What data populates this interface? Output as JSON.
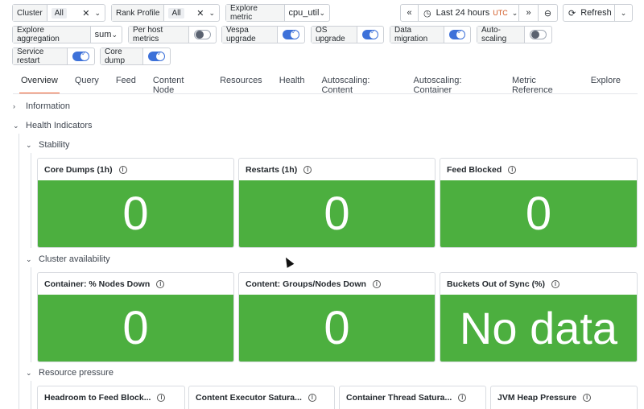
{
  "controls": {
    "cluster": {
      "label": "Cluster",
      "value": "All"
    },
    "rank_profile": {
      "label": "Rank Profile",
      "value": "All"
    },
    "explore_metric": {
      "label": "Explore metric",
      "value": "cpu_util"
    },
    "explore_aggregation": {
      "label": "Explore aggregation",
      "value": "sum"
    },
    "per_host_metrics": {
      "label": "Per host metrics",
      "on": false
    },
    "vespa_upgrade": {
      "label": "Vespa upgrade",
      "on": true
    },
    "os_upgrade": {
      "label": "OS upgrade",
      "on": true
    },
    "data_migration": {
      "label": "Data migration",
      "on": true
    },
    "auto_scaling": {
      "label": "Auto-scaling",
      "on": false
    },
    "service_restart": {
      "label": "Service restart",
      "on": true
    },
    "core_dump": {
      "label": "Core dump",
      "on": true
    }
  },
  "timebar": {
    "range_label": "Last 24 hours",
    "tz": "UTC",
    "refresh_label": "Refresh"
  },
  "tabs": [
    "Overview",
    "Query",
    "Feed",
    "Content Node",
    "Resources",
    "Health",
    "Autoscaling: Content",
    "Autoscaling: Container",
    "Metric Reference",
    "Explore"
  ],
  "rows": {
    "information": "Information",
    "health_indicators": "Health Indicators",
    "stability": "Stability",
    "cluster_availability": "Cluster availability",
    "resource_pressure": "Resource pressure"
  },
  "stability_panels": [
    {
      "title": "Core Dumps (1h)",
      "value": "0"
    },
    {
      "title": "Restarts (1h)",
      "value": "0"
    },
    {
      "title": "Feed Blocked",
      "value": "0"
    }
  ],
  "availability_panels": [
    {
      "title": "Container: % Nodes Down",
      "value": "0"
    },
    {
      "title": "Content: Groups/Nodes Down",
      "value": "0"
    },
    {
      "title": "Buckets Out of Sync (%)",
      "value": "No data"
    }
  ],
  "pressure_panels": [
    {
      "title": "Headroom to Feed Block..."
    },
    {
      "title": "Content Executor Satura..."
    },
    {
      "title": "Container Thread Satura..."
    },
    {
      "title": "JVM Heap Pressure"
    }
  ],
  "colors": {
    "panel_ok": "#4caf3f",
    "tab_active": "#f05a28",
    "toggle_on": "#3d71d9"
  }
}
